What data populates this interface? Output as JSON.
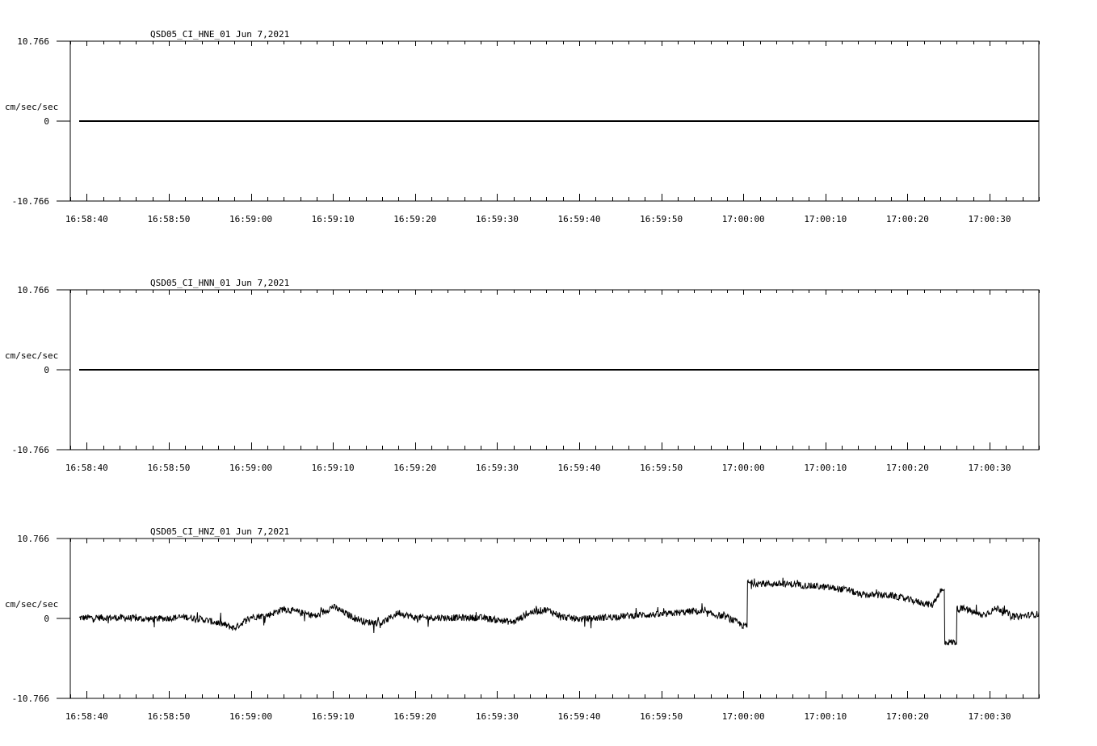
{
  "chart_data": [
    {
      "type": "line",
      "title": "QSD05_CI_HNE_01  Jun 7,2021",
      "ylabel": "cm/sec/sec",
      "ylim": [
        -10.766,
        10.766
      ],
      "y_tick_labels": [
        "10.766",
        "0",
        "-10.766"
      ],
      "x_tick_labels": [
        "16:58:40",
        "16:58:50",
        "16:59:00",
        "16:59:10",
        "16:59:20",
        "16:59:30",
        "16:59:40",
        "16:59:50",
        "17:00:00",
        "17:00:10",
        "17:00:20",
        "17:00:30"
      ],
      "x": [
        "16:58:38",
        "17:00:36"
      ],
      "series": [
        {
          "values": [
            0,
            0
          ]
        }
      ]
    },
    {
      "type": "line",
      "title": "QSD05_CI_HNN_01  Jun 7,2021",
      "ylabel": "cm/sec/sec",
      "ylim": [
        -10.766,
        10.766
      ],
      "y_tick_labels": [
        "10.766",
        "0",
        "-10.766"
      ],
      "x_tick_labels": [
        "16:58:40",
        "16:58:50",
        "16:59:00",
        "16:59:10",
        "16:59:20",
        "16:59:30",
        "16:59:40",
        "16:59:50",
        "17:00:00",
        "17:00:10",
        "17:00:20",
        "17:00:30"
      ],
      "x": [
        "16:58:38",
        "17:00:36"
      ],
      "series": [
        {
          "values": [
            0,
            0
          ]
        }
      ]
    },
    {
      "type": "line",
      "title": "QSD05_CI_HNZ_01  Jun 7,2021",
      "ylabel": "cm/sec/sec",
      "ylim": [
        -10.766,
        10.766
      ],
      "y_tick_labels": [
        "10.766",
        "0",
        "-10.766"
      ],
      "x_tick_labels": [
        "16:58:40",
        "16:58:50",
        "16:59:00",
        "16:59:10",
        "16:59:20",
        "16:59:30",
        "16:59:40",
        "16:59:50",
        "17:00:00",
        "17:00:10",
        "17:00:20",
        "17:00:30"
      ],
      "x": [
        "16:58:38",
        "16:58:40",
        "16:58:44",
        "16:58:48",
        "16:58:52",
        "16:58:54",
        "16:58:56",
        "16:58:58",
        "16:59:00",
        "16:59:02",
        "16:59:04",
        "16:59:06",
        "16:59:08",
        "16:59:10",
        "16:59:12",
        "16:59:14",
        "16:59:16",
        "16:59:18",
        "16:59:20",
        "16:59:24",
        "16:59:28",
        "16:59:30",
        "16:59:32",
        "16:59:34",
        "16:59:36",
        "16:59:38",
        "16:59:40",
        "16:59:44",
        "16:59:48",
        "16:59:50",
        "16:59:54",
        "16:59:58",
        "17:00:00",
        "17:00:01",
        "17:00:02",
        "17:00:06",
        "17:00:10",
        "17:00:13",
        "17:00:14",
        "17:00:18",
        "17:00:21",
        "17:00:23",
        "17:00:24",
        "17:00:25",
        "17:00:27",
        "17:00:29",
        "17:00:31",
        "17:00:33",
        "17:00:36"
      ],
      "series": [
        {
          "values": [
            0,
            0.1,
            0.1,
            -0.1,
            0.2,
            -0.1,
            -0.6,
            -1.3,
            0.2,
            0.4,
            1.3,
            0.8,
            0.3,
            1.6,
            0.4,
            -0.5,
            -0.6,
            0.8,
            0.1,
            0.1,
            0.1,
            -0.2,
            -0.5,
            0.8,
            1.2,
            0.2,
            -0.1,
            0.2,
            0.5,
            0.5,
            1.0,
            0.2,
            -1.0,
            4.8,
            4.7,
            4.6,
            4.2,
            3.8,
            3.2,
            3.1,
            2.3,
            1.8,
            3.7,
            -3.2,
            1.3,
            0.4,
            1.4,
            0.2,
            0.6
          ]
        }
      ]
    }
  ]
}
